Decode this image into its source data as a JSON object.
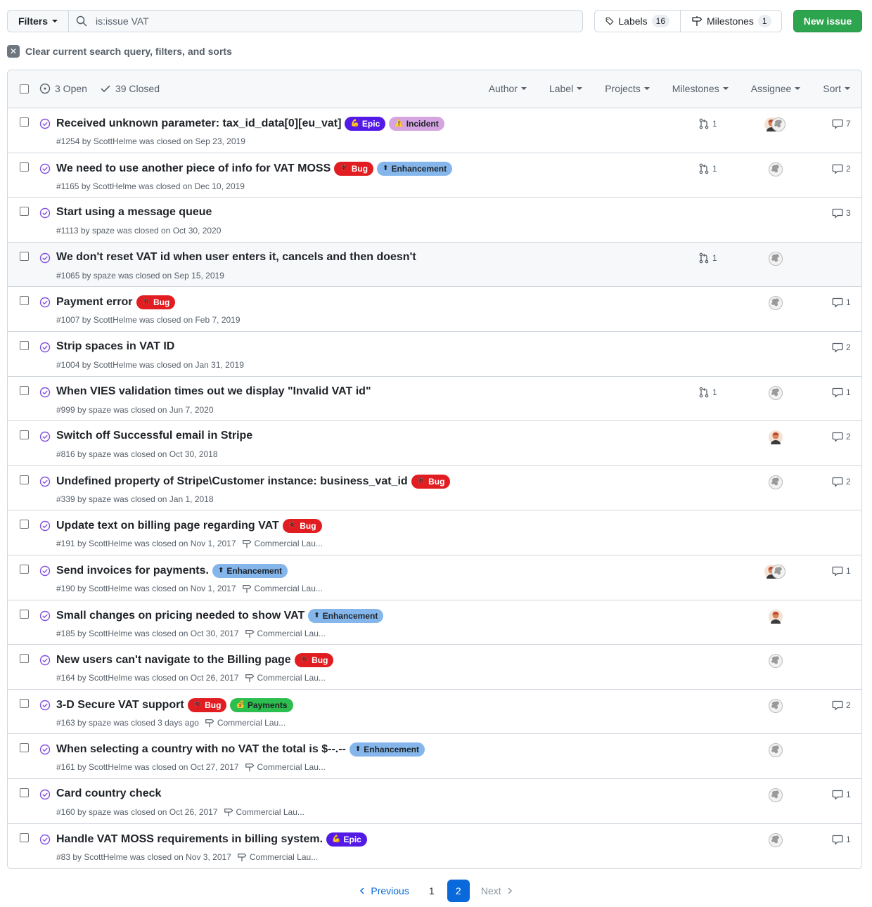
{
  "toolbar": {
    "filters_label": "Filters",
    "search_value": "is:issue VAT",
    "labels_label": "Labels",
    "labels_count": "16",
    "milestones_label": "Milestones",
    "milestones_count": "1",
    "new_issue_label": "New issue"
  },
  "clear_query_label": "Clear current search query, filters, and sorts",
  "header": {
    "open_label": "3 Open",
    "closed_label": "39 Closed",
    "filters": [
      "Author",
      "Label",
      "Projects",
      "Milestones",
      "Assignee",
      "Sort"
    ]
  },
  "issues": [
    {
      "title": "Received unknown parameter: tax_id_data[0][eu_vat]",
      "labels": [
        {
          "name": "Epic",
          "type": "epic",
          "emoji": "💪"
        },
        {
          "name": "Incident",
          "type": "incident",
          "emoji": "⚠️"
        }
      ],
      "number": "#1254",
      "author": "ScottHelme",
      "closed": "was closed on Sep 23, 2019",
      "milestone": "",
      "pr": "1",
      "avatars": [
        "orange",
        "grey"
      ],
      "comments": "7"
    },
    {
      "title": "We need to use another piece of info for VAT MOSS",
      "labels": [
        {
          "name": "Bug",
          "type": "bug",
          "emoji": "🐞"
        },
        {
          "name": "Enhancement",
          "type": "enh",
          "emoji": "⬆"
        }
      ],
      "number": "#1165",
      "author": "ScottHelme",
      "closed": "was closed on Dec 10, 2019",
      "milestone": "",
      "pr": "1",
      "avatars": [
        "grey"
      ],
      "comments": "2"
    },
    {
      "title": "Start using a message queue",
      "labels": [],
      "number": "#1113",
      "author": "spaze",
      "closed": "was closed on Oct 30, 2020",
      "milestone": "",
      "pr": "",
      "avatars": [],
      "comments": "3"
    },
    {
      "title": "We don't reset VAT id when user enters it, cancels and then doesn't",
      "labels": [],
      "number": "#1065",
      "author": "spaze",
      "closed": "was closed on Sep 15, 2019",
      "milestone": "",
      "pr": "1",
      "avatars": [
        "grey"
      ],
      "comments": ""
    },
    {
      "title": "Payment error",
      "labels": [
        {
          "name": "Bug",
          "type": "bug",
          "emoji": "🐞"
        }
      ],
      "number": "#1007",
      "author": "ScottHelme",
      "closed": "was closed on Feb 7, 2019",
      "milestone": "",
      "pr": "",
      "avatars": [
        "grey"
      ],
      "comments": "1"
    },
    {
      "title": "Strip spaces in VAT ID",
      "labels": [],
      "number": "#1004",
      "author": "ScottHelme",
      "closed": "was closed on Jan 31, 2019",
      "milestone": "",
      "pr": "",
      "avatars": [],
      "comments": "2"
    },
    {
      "title": "When VIES validation times out we display \"Invalid VAT id\"",
      "labels": [],
      "number": "#999",
      "author": "spaze",
      "closed": "was closed on Jun 7, 2020",
      "milestone": "",
      "pr": "1",
      "avatars": [
        "grey"
      ],
      "comments": "1"
    },
    {
      "title": "Switch off Successful email in Stripe",
      "labels": [],
      "number": "#816",
      "author": "spaze",
      "closed": "was closed on Oct 30, 2018",
      "milestone": "",
      "pr": "",
      "avatars": [
        "orange"
      ],
      "comments": "2"
    },
    {
      "title": "Undefined property of Stripe\\Customer instance: business_vat_id",
      "labels": [
        {
          "name": "Bug",
          "type": "bug",
          "emoji": "🐞"
        }
      ],
      "number": "#339",
      "author": "spaze",
      "closed": "was closed on Jan 1, 2018",
      "milestone": "",
      "pr": "",
      "avatars": [
        "grey"
      ],
      "comments": "2"
    },
    {
      "title": "Update text on billing page regarding VAT",
      "labels": [
        {
          "name": "Bug",
          "type": "bug",
          "emoji": "🐞"
        }
      ],
      "number": "#191",
      "author": "ScottHelme",
      "closed": "was closed on Nov 1, 2017",
      "milestone": "Commercial Lau...",
      "pr": "",
      "avatars": [],
      "comments": ""
    },
    {
      "title": "Send invoices for payments.",
      "labels": [
        {
          "name": "Enhancement",
          "type": "enh",
          "emoji": "⬆"
        }
      ],
      "number": "#190",
      "author": "ScottHelme",
      "closed": "was closed on Nov 1, 2017",
      "milestone": "Commercial Lau...",
      "pr": "",
      "avatars": [
        "orange",
        "grey"
      ],
      "comments": "1"
    },
    {
      "title": "Small changes on pricing needed to show VAT",
      "labels": [
        {
          "name": "Enhancement",
          "type": "enh",
          "emoji": "⬆"
        }
      ],
      "number": "#185",
      "author": "ScottHelme",
      "closed": "was closed on Oct 30, 2017",
      "milestone": "Commercial Lau...",
      "pr": "",
      "avatars": [
        "orange"
      ],
      "comments": ""
    },
    {
      "title": "New users can't navigate to the Billing page",
      "labels": [
        {
          "name": "Bug",
          "type": "bug",
          "emoji": "🐞"
        }
      ],
      "number": "#164",
      "author": "ScottHelme",
      "closed": "was closed on Oct 26, 2017",
      "milestone": "Commercial Lau...",
      "pr": "",
      "avatars": [
        "grey"
      ],
      "comments": ""
    },
    {
      "title": "3-D Secure VAT support",
      "labels": [
        {
          "name": "Bug",
          "type": "bug",
          "emoji": "🐞"
        },
        {
          "name": "Payments",
          "type": "pay",
          "emoji": "💰"
        }
      ],
      "number": "#163",
      "author": "spaze",
      "closed": "was closed 3 days ago",
      "milestone": "Commercial Lau...",
      "pr": "",
      "avatars": [
        "grey"
      ],
      "comments": "2"
    },
    {
      "title": "When selecting a country with no VAT the total is $--.--",
      "labels": [
        {
          "name": "Enhancement",
          "type": "enh",
          "emoji": "⬆"
        }
      ],
      "number": "#161",
      "author": "ScottHelme",
      "closed": "was closed on Oct 27, 2017",
      "milestone": "Commercial Lau...",
      "pr": "",
      "avatars": [
        "grey"
      ],
      "comments": ""
    },
    {
      "title": "Card country check",
      "labels": [],
      "number": "#160",
      "author": "spaze",
      "closed": "was closed on Oct 26, 2017",
      "milestone": "Commercial Lau...",
      "pr": "",
      "avatars": [
        "grey"
      ],
      "comments": "1"
    },
    {
      "title": "Handle VAT MOSS requirements in billing system.",
      "labels": [
        {
          "name": "Epic",
          "type": "epic",
          "emoji": "💪"
        }
      ],
      "number": "#83",
      "author": "ScottHelme",
      "closed": "was closed on Nov 3, 2017",
      "milestone": "Commercial Lau...",
      "pr": "",
      "avatars": [
        "grey"
      ],
      "comments": "1"
    }
  ],
  "pagination": {
    "previous_label": "Previous",
    "next_label": "Next",
    "pages": [
      "1",
      "2"
    ],
    "current": "2"
  },
  "colors": {
    "primary_button": "#2da44e",
    "closed_icon": "#8250df",
    "link": "#0969da",
    "border": "#d0d7de"
  }
}
